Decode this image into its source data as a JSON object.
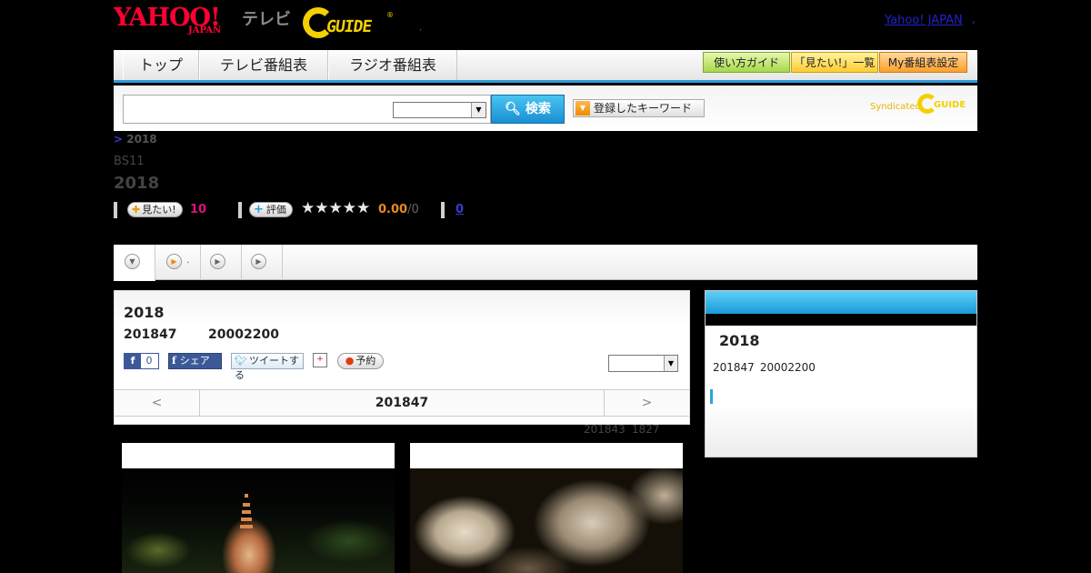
{
  "header": {
    "yahoo_logo": "YAHOO!",
    "yahoo_japan_sub": "JAPAN",
    "tv_label": "テレビ",
    "gguide_logo": "GUIDE",
    "gguide_reg": "®",
    "header_dot": ",",
    "yahoo_japan_link": "Yahoo! JAPAN",
    "link_dot": ","
  },
  "nav": {
    "tabs": [
      {
        "label": "トップ"
      },
      {
        "label": "テレビ番組表"
      },
      {
        "label": "ラジオ番組表"
      }
    ],
    "guide_button": "使い方ガイド",
    "want_list_button": "「見たい!」一覧",
    "my_schedule_button": "My番組表設定"
  },
  "search": {
    "input_value": "",
    "select_value": "",
    "search_button": "検索",
    "keyword_button": "登録したキーワード",
    "syndicated_label": "Syndicated",
    "syndicated_logo": "GUIDE"
  },
  "program": {
    "breadcrumb_sep": ">",
    "breadcrumb_current": "2018",
    "channel": "BS11",
    "title": "2018",
    "want_button": "見たい!",
    "want_count": "10",
    "rate_button": "評価",
    "stars": "★★★★★",
    "rating_value": "0.00",
    "rating_total": "/0",
    "comment_count": "0"
  },
  "subtabs": {
    "tab2_suffix": "."
  },
  "main": {
    "title": "2018",
    "date": "201847",
    "time": "20002200",
    "fb_like_count": "0",
    "fb_share_label": "シェア",
    "tweet_label": "ツイートする",
    "reserve_label": "予約",
    "select_value": "",
    "date_nav": {
      "prev": "<",
      "current": "201847",
      "next": ">"
    },
    "updated_date": "201843",
    "updated_time": "1827"
  },
  "sidebar": {
    "title": "2018",
    "date": "201847",
    "time": "20002200"
  },
  "colors": {
    "accent_blue": "#2f9ad8",
    "want_pink": "#e0107a",
    "rating_orange": "#e88a20",
    "brand_red": "#ff0033",
    "gguide_yellow": "#f4d000"
  }
}
